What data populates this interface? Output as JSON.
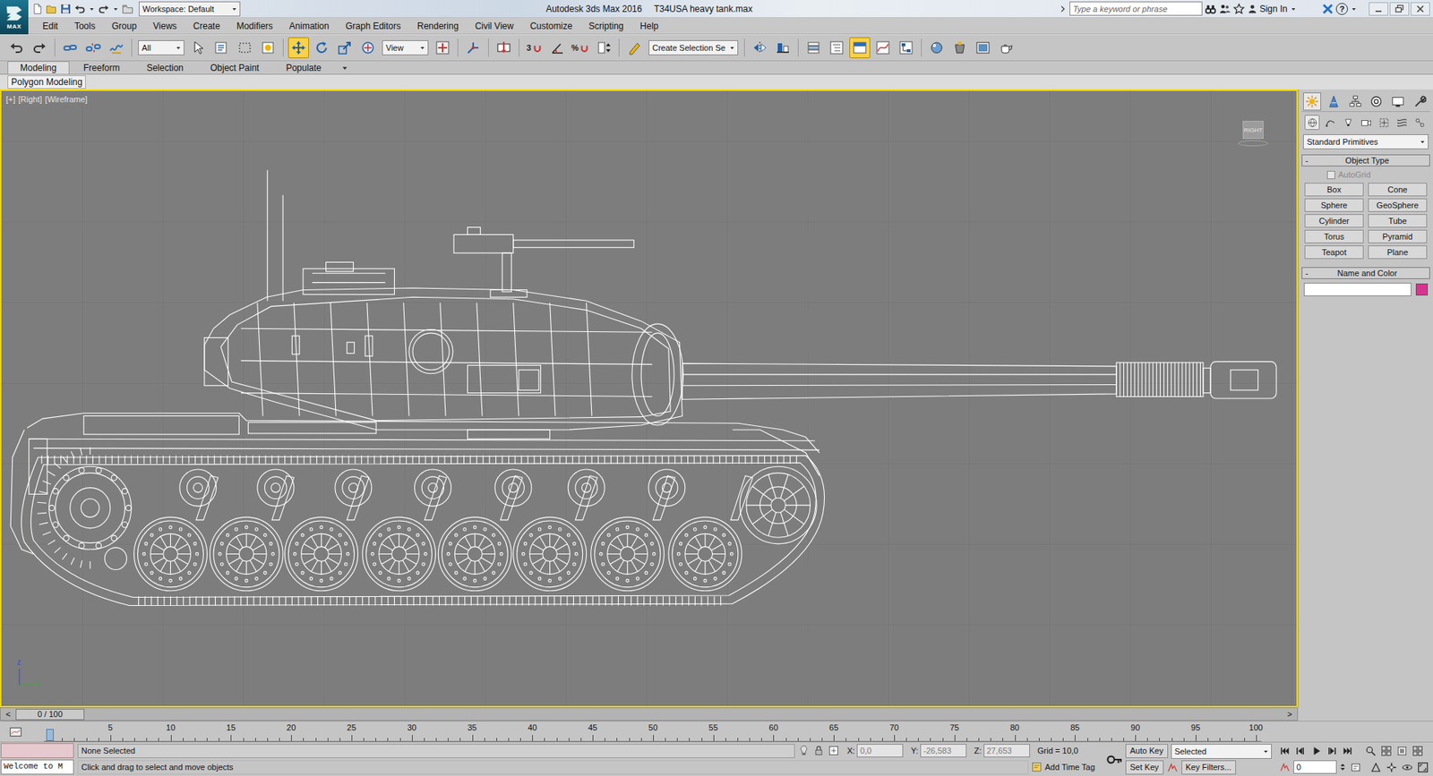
{
  "window": {
    "logo": "MAX",
    "title": "Autodesk 3ds Max 2016",
    "file": "T34USA heavy tank.max"
  },
  "workspace": {
    "label": "Workspace: Default"
  },
  "search": {
    "placeholder": "Type a keyword or phrase"
  },
  "account": {
    "sign_in": "Sign In"
  },
  "help": {
    "label": "?"
  },
  "menu": [
    "Edit",
    "Tools",
    "Group",
    "Views",
    "Create",
    "Modifiers",
    "Animation",
    "Graph Editors",
    "Rendering",
    "Civil View",
    "Customize",
    "Scripting",
    "Help"
  ],
  "toolbar": {
    "items": [
      {
        "kind": "undo",
        "selected": false
      },
      {
        "kind": "redo",
        "selected": false
      },
      {
        "kind": "separator"
      },
      {
        "kind": "link",
        "selected": false
      },
      {
        "kind": "unlink",
        "selected": false
      },
      {
        "kind": "bind",
        "selected": false
      },
      {
        "kind": "separator"
      },
      {
        "kind": "dropdown",
        "label": "All"
      },
      {
        "kind": "select",
        "selected": false
      },
      {
        "kind": "selname",
        "selected": false
      },
      {
        "kind": "rectsel",
        "selected": false
      },
      {
        "kind": "window",
        "selected": false
      },
      {
        "kind": "separator"
      },
      {
        "kind": "move",
        "selected": true
      },
      {
        "kind": "rotate",
        "selected": false
      },
      {
        "kind": "scale",
        "selected": false
      },
      {
        "kind": "place",
        "selected": false
      },
      {
        "kind": "dropdown",
        "label": "View"
      },
      {
        "kind": "pivot",
        "selected": false
      },
      {
        "kind": "separator"
      },
      {
        "kind": "manip",
        "selected": false
      },
      {
        "kind": "separator"
      },
      {
        "kind": "keyb",
        "selected": false
      },
      {
        "kind": "separator"
      },
      {
        "kind": "snap",
        "label": "3",
        "selected": false
      },
      {
        "kind": "angle",
        "selected": false
      },
      {
        "kind": "snap",
        "label": "%",
        "selected": false
      },
      {
        "kind": "spinner",
        "selected": false
      },
      {
        "kind": "separator"
      },
      {
        "kind": "editnamed",
        "selected": false
      },
      {
        "kind": "dropdown",
        "label": "Create Selection Se"
      },
      {
        "kind": "separator"
      },
      {
        "kind": "mirror",
        "selected": false
      },
      {
        "kind": "align",
        "selected": false
      },
      {
        "kind": "separator"
      },
      {
        "kind": "layers",
        "selected": false
      },
      {
        "kind": "scene",
        "selected": false
      },
      {
        "kind": "ribbontoggle",
        "selected": true
      },
      {
        "kind": "curve",
        "selected": false
      },
      {
        "kind": "schematic",
        "selected": false
      },
      {
        "kind": "separator"
      },
      {
        "kind": "material",
        "selected": false
      },
      {
        "kind": "rendersetup",
        "selected": false
      },
      {
        "kind": "renderframe",
        "selected": false
      },
      {
        "kind": "teapot",
        "selected": false
      }
    ]
  },
  "ribbon": {
    "tabs": [
      {
        "label": "Modeling",
        "selected": true
      },
      {
        "label": "Freeform",
        "selected": false
      },
      {
        "label": "Selection",
        "selected": false
      },
      {
        "label": "Object Paint",
        "selected": false
      },
      {
        "label": "Populate",
        "selected": false
      }
    ],
    "panel": {
      "label": "Polygon Modeling"
    }
  },
  "viewport": {
    "labels": [
      "[+]",
      "[Right]",
      "[Wireframe]"
    ],
    "active": true,
    "viewcube": "RIGHT",
    "axes": {
      "vertical": "z",
      "horizontal": "y"
    }
  },
  "command_panel": {
    "tabs": [
      {
        "kind": "create",
        "selected": true
      },
      {
        "kind": "modify",
        "selected": false
      },
      {
        "kind": "hierarchy",
        "selected": false
      },
      {
        "kind": "motion",
        "selected": false
      },
      {
        "kind": "display",
        "selected": false
      },
      {
        "kind": "utilities",
        "selected": false
      }
    ],
    "categories": [
      {
        "kind": "geometry",
        "selected": true
      },
      {
        "kind": "shapes",
        "selected": false
      },
      {
        "kind": "lights",
        "selected": false
      },
      {
        "kind": "cameras",
        "selected": false
      },
      {
        "kind": "helpers",
        "selected": false
      },
      {
        "kind": "spacewarps",
        "selected": false
      },
      {
        "kind": "systems",
        "selected": false
      }
    ],
    "dropdown": "Standard Primitives",
    "object_type": {
      "toggle": "-",
      "title": "Object Type",
      "autogrid": {
        "label": "AutoGrid",
        "checked": false,
        "disabled": true
      },
      "buttons": [
        "Box",
        "Cone",
        "Sphere",
        "GeoSphere",
        "Cylinder",
        "Tube",
        "Torus",
        "Pyramid",
        "Teapot",
        "Plane"
      ]
    },
    "name_and_color": {
      "toggle": "-",
      "title": "Name and Color",
      "color": "#d4368f"
    }
  },
  "time_slider": {
    "label": "0 / 100",
    "prev": "<",
    "next": ">",
    "level": 0
  },
  "track_bar": {
    "labels": [
      "5",
      "10",
      "15",
      "20",
      "25",
      "30",
      "35",
      "40",
      "45",
      "50",
      "55",
      "60",
      "65",
      "70",
      "75",
      "80",
      "85",
      "90",
      "95",
      "100"
    ]
  },
  "status": {
    "listener": "Welcome to M",
    "selection": "None Selected",
    "prompt": "Click and drag to select and move objects",
    "coords": [
      {
        "label": "X:",
        "value": "0,0",
        "disabled": true
      },
      {
        "label": "Y:",
        "value": "-26,583",
        "disabled": true
      },
      {
        "label": "Z:",
        "value": "27,653",
        "disabled": true
      }
    ],
    "grid": "Grid = 10,0",
    "add_time_tag": "Add Time Tag",
    "auto_key": {
      "label": "Auto Key",
      "on": false
    },
    "key_mode": "Selected",
    "set_key": "Set Key",
    "key_filters": "Key Filters...",
    "frame": "0"
  }
}
